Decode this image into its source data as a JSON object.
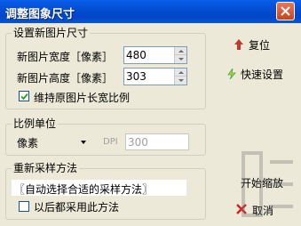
{
  "window": {
    "title": "调整图象尺寸"
  },
  "size_group": {
    "title": "设置新图片尺寸",
    "width_label": "新图片宽度［像素］",
    "width_value": "480",
    "height_label": "新图片高度［像素］",
    "height_value": "303",
    "keep_ratio_label": "维持原图片长宽比例",
    "keep_ratio_checked": true
  },
  "unit_group": {
    "title": "比例单位",
    "unit_value": "像素",
    "dpi_label": "DPI",
    "dpi_value": "300"
  },
  "resample_group": {
    "title": "重新采样方法",
    "method_value": "〖自动选择合适的采样方法〗",
    "remember_label": "以后都采用此方法"
  },
  "buttons": {
    "reset_label": "复位",
    "quick_label": "快速设置",
    "start_label": "开始缩放",
    "cancel_label": "取消"
  },
  "colors": {
    "titlebar": "#0350d6",
    "reset_icon": "#c0392b",
    "cancel_icon": "#d21f1f"
  }
}
